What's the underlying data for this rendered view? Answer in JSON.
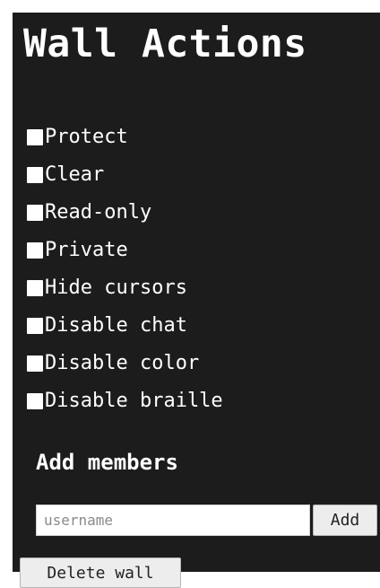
{
  "title": "Wall Actions",
  "options": [
    {
      "label": "Protect",
      "checked": false
    },
    {
      "label": "Clear",
      "checked": false
    },
    {
      "label": "Read-only",
      "checked": false
    },
    {
      "label": "Private",
      "checked": false
    },
    {
      "label": "Hide cursors",
      "checked": false
    },
    {
      "label": "Disable chat",
      "checked": false
    },
    {
      "label": "Disable color",
      "checked": false
    },
    {
      "label": "Disable braille",
      "checked": false
    }
  ],
  "members": {
    "heading": "Add members",
    "input_value": "",
    "input_placeholder": "username",
    "add_label": "Add"
  },
  "delete_label": "Delete wall",
  "colors": {
    "panel_background": "#1c1c1c",
    "text": "#ffffff",
    "button_background": "#ededed"
  }
}
